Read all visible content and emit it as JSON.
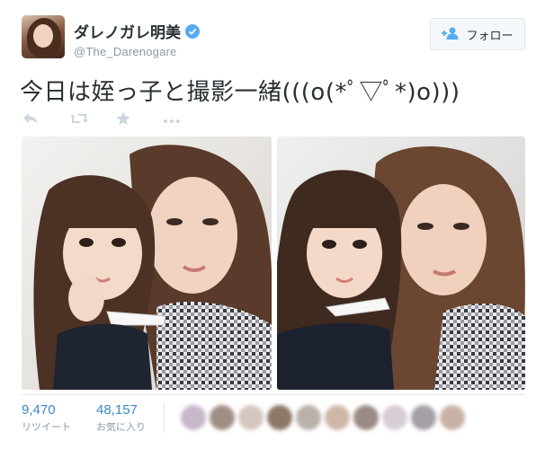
{
  "user": {
    "display_name": "ダレノガレ明美",
    "screen_name": "@The_Darenogare",
    "verified": true
  },
  "follow_button": {
    "label": "フォロー",
    "icon": "add-user-icon"
  },
  "tweet": {
    "text": "今日は姪っ子と撮影一緒(((o(*ﾟ▽ﾟ*)o)))"
  },
  "actions": [
    {
      "name": "reply",
      "icon": "reply-icon"
    },
    {
      "name": "retweet",
      "icon": "retweet-icon"
    },
    {
      "name": "favorite",
      "icon": "star-icon"
    },
    {
      "name": "more",
      "icon": "more-icon"
    }
  ],
  "photos": [
    {
      "name": "photo-1",
      "description_icon": "photo-icon"
    },
    {
      "name": "photo-2",
      "description_icon": "photo-icon"
    }
  ],
  "stats": {
    "retweets": {
      "count": "9,470",
      "label": "リツイート"
    },
    "favorites": {
      "count": "48,157",
      "label": "お気に入り"
    }
  },
  "colors": {
    "accent": "#55acee",
    "link": "#3b88c3",
    "muted": "#8899a6",
    "border": "#e1e8ed"
  }
}
